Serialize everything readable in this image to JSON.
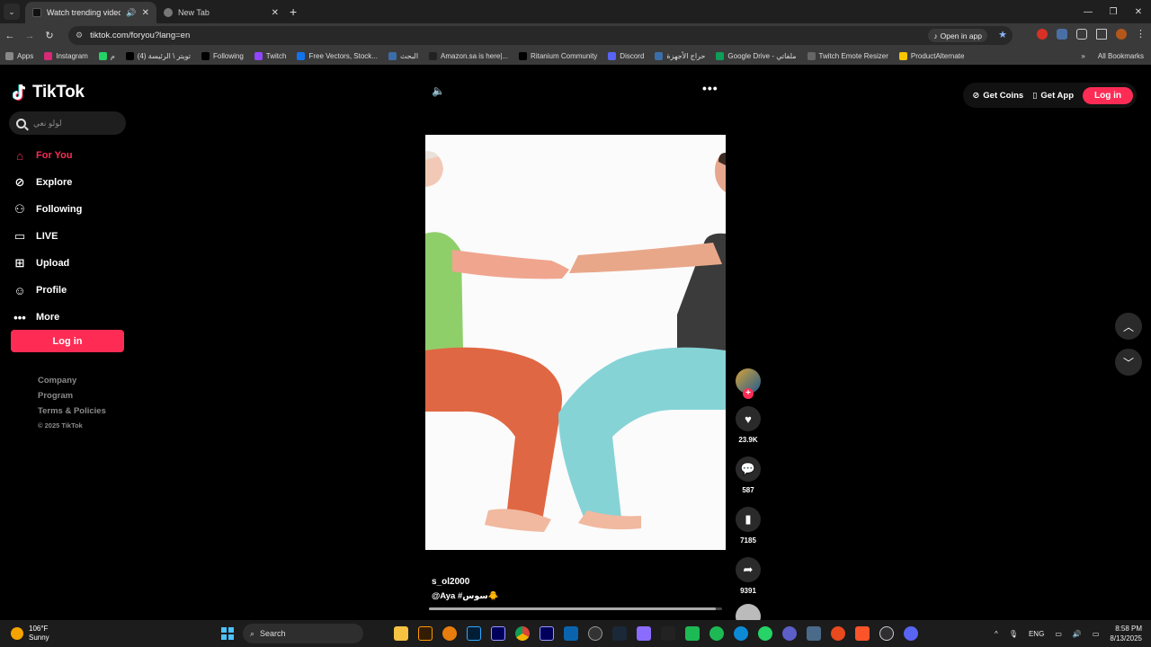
{
  "browser": {
    "tabs": [
      {
        "title": "Watch trending videos for y",
        "active": true,
        "audio_icon": "speaker-icon"
      },
      {
        "title": "New Tab",
        "active": false
      }
    ],
    "url": "tiktok.com/foryou?lang=en",
    "open_in_app": "Open in app",
    "bookmarks": [
      {
        "label": "Apps",
        "icon": "apps-grid-icon"
      },
      {
        "label": "Instagram",
        "icon": "instagram-icon"
      },
      {
        "label": "م",
        "icon": "whatsapp-icon"
      },
      {
        "label": "(4) تويتر \\ الرئيسة",
        "icon": "x-icon"
      },
      {
        "label": "Following",
        "icon": "x-icon"
      },
      {
        "label": "Twitch",
        "icon": "twitch-icon"
      },
      {
        "label": "Free Vectors, Stock...",
        "icon": "freepik-icon"
      },
      {
        "label": "البحث",
        "icon": "site-icon"
      },
      {
        "label": "Amazon.sa is here|...",
        "icon": "amazon-icon"
      },
      {
        "label": "Ritanium Community",
        "icon": "x-icon"
      },
      {
        "label": "Discord",
        "icon": "discord-icon"
      },
      {
        "label": "حراج الأجهزة",
        "icon": "site-icon"
      },
      {
        "label": "Google Drive - ملفاتي",
        "icon": "drive-icon"
      },
      {
        "label": "Twitch Emote Resizer",
        "icon": "globe-icon"
      },
      {
        "label": "ProductAlternate",
        "icon": "pa-icon"
      }
    ],
    "all_bookmarks": "All Bookmarks"
  },
  "tiktok": {
    "logo": "TikTok",
    "search_placeholder": "لولو نعي",
    "menu": [
      {
        "label": "For You",
        "icon": "home-icon",
        "active": true
      },
      {
        "label": "Explore",
        "icon": "compass-icon"
      },
      {
        "label": "Following",
        "icon": "following-icon"
      },
      {
        "label": "LIVE",
        "icon": "live-tv-icon"
      },
      {
        "label": "Upload",
        "icon": "upload-plus-icon"
      },
      {
        "label": "Profile",
        "icon": "profile-icon"
      },
      {
        "label": "More",
        "icon": "more-dots-icon"
      }
    ],
    "login": "Log in",
    "footer": [
      "Company",
      "Program",
      "Terms & Policies"
    ],
    "copyright": "© 2025 TikTok",
    "top_right": {
      "get_coins": "Get Coins",
      "get_app": "Get App",
      "login": "Log in"
    },
    "video": {
      "username": "s_ol2000",
      "caption": "@Aya  #سوس🐥",
      "likes": "23.9K",
      "comments": "587",
      "saves": "7185",
      "shares": "9391",
      "progress": 0.98
    }
  },
  "taskbar": {
    "weather_temp": "106°F",
    "weather_desc": "Sunny",
    "search": "Search",
    "language": "ENG",
    "time": "8:58 PM",
    "date": "8/13/2025"
  }
}
